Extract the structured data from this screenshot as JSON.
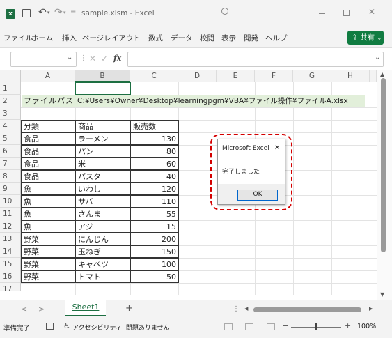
{
  "titlebar": {
    "title": "sample.xlsm - Excel",
    "autosave_icon": "save-icon",
    "undo_icon": "undo-icon",
    "redo_icon": "redo-icon",
    "qat_more": "="
  },
  "menu": {
    "items": [
      "ファイル",
      "ホーム",
      "挿入",
      "ページレイアウト",
      "数式",
      "データ",
      "校閲",
      "表示",
      "開発",
      "ヘルプ"
    ],
    "share_label": "共有"
  },
  "formula": {
    "namebox": "",
    "fx": "fx",
    "value": ""
  },
  "grid": {
    "columns": [
      "A",
      "B",
      "C",
      "D",
      "E",
      "F",
      "G",
      "H"
    ],
    "rows": [
      "1",
      "2",
      "3",
      "4",
      "5",
      "6",
      "7",
      "8",
      "9",
      "10",
      "11",
      "12",
      "13",
      "14",
      "15",
      "16",
      "17"
    ],
    "row2": {
      "a": "ファイルパス",
      "b": "C:¥Users¥Owner¥Desktop¥learningpgm¥VBA¥ファイル操作¥ファイルA.xlsx"
    },
    "table_headers": [
      "分類",
      "商品",
      "販売数"
    ],
    "table_rows": [
      [
        "食品",
        "ラーメン",
        "130"
      ],
      [
        "食品",
        "パン",
        "80"
      ],
      [
        "食品",
        "米",
        "60"
      ],
      [
        "食品",
        "パスタ",
        "40"
      ],
      [
        "魚",
        "いわし",
        "120"
      ],
      [
        "魚",
        "サバ",
        "110"
      ],
      [
        "魚",
        "さんま",
        "55"
      ],
      [
        "魚",
        "アジ",
        "15"
      ],
      [
        "野菜",
        "にんじん",
        "200"
      ],
      [
        "野菜",
        "玉ねぎ",
        "150"
      ],
      [
        "野菜",
        "キャベツ",
        "100"
      ],
      [
        "野菜",
        "トマト",
        "50"
      ]
    ]
  },
  "dialog": {
    "title": "Microsoft Excel",
    "message": "完了しました",
    "ok": "OK",
    "close": "✕"
  },
  "sheets": {
    "active": "Sheet1",
    "add": "+",
    "prev": "<",
    "next": ">"
  },
  "status": {
    "ready": "準備完了",
    "accessibility": "アクセシビリティ: 問題ありません",
    "zoom": "100%",
    "zoom_minus": "−",
    "zoom_plus": "+"
  },
  "colors": {
    "excel_green": "#1d6f42",
    "share_green": "#107c41",
    "path_fill": "#e2efda",
    "annotation_red": "#d40000"
  }
}
